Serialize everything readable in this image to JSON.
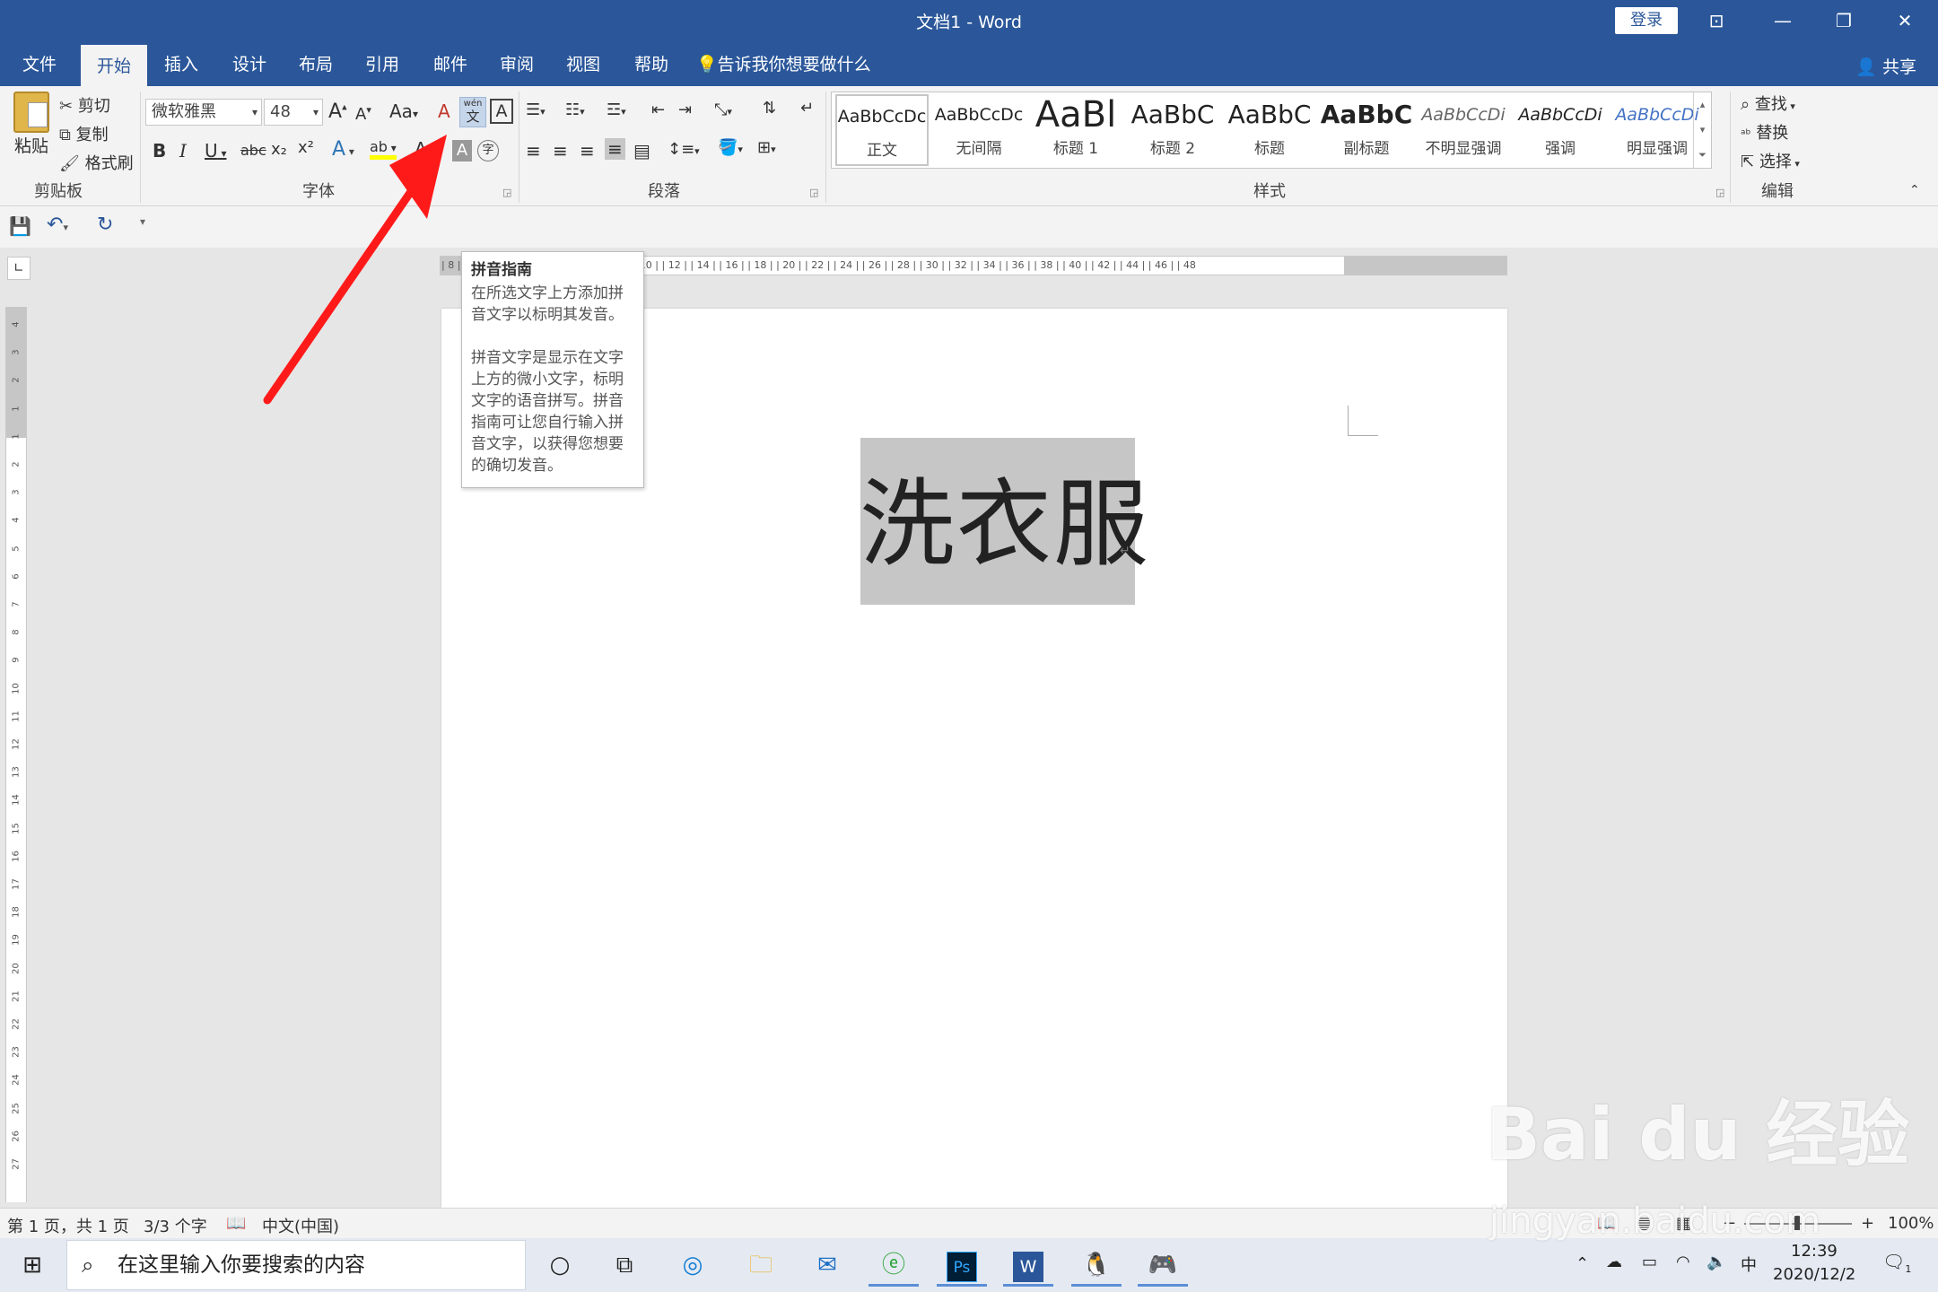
{
  "window": {
    "title": "文档1  -  Word",
    "login": "登录",
    "controls": {
      "ribbon_display": "⊡",
      "minimize": "—",
      "restore": "❐",
      "close": "✕"
    }
  },
  "tabs": {
    "file": "文件",
    "home": "开始",
    "insert": "插入",
    "design": "设计",
    "layout": "布局",
    "references": "引用",
    "mailings": "邮件",
    "review": "审阅",
    "view": "视图",
    "help": "帮助",
    "tell_me": "告诉我你想要做什么",
    "share": "共享"
  },
  "clipboard": {
    "paste": "粘贴",
    "cut": "剪切",
    "copy": "复制",
    "format_painter": "格式刷",
    "label": "剪贴板"
  },
  "font": {
    "name": "微软雅黑",
    "size": "48",
    "grow": "A",
    "shrink": "A",
    "change_case": "Aa",
    "clear": "A",
    "phonetic_top": "wén",
    "phonetic_bottom": "文",
    "border": "A",
    "bold": "B",
    "italic": "I",
    "underline": "U",
    "strike": "abc",
    "subscript": "x₂",
    "superscript": "x²",
    "effects": "A",
    "highlight": "ab",
    "color": "A",
    "shade": "A",
    "enclose": "字",
    "label": "字体"
  },
  "paragraph": {
    "label": "段落"
  },
  "styles": {
    "label": "样式",
    "items": [
      {
        "preview": "AaBbCcDc",
        "name": "正文"
      },
      {
        "preview": "AaBbCcDc",
        "name": "无间隔"
      },
      {
        "preview": "AaBl",
        "name": "标题 1"
      },
      {
        "preview": "AaBbC",
        "name": "标题 2"
      },
      {
        "preview": "AaBbC",
        "name": "标题"
      },
      {
        "preview": "AaBbC",
        "name": "副标题"
      },
      {
        "preview": "AaBbCcDi",
        "name": "不明显强调"
      },
      {
        "preview": "AaBbCcDi",
        "name": "强调"
      },
      {
        "preview": "AaBbCcDi",
        "name": "明显强调"
      }
    ]
  },
  "editing": {
    "find": "查找",
    "replace": "替换",
    "select": "选择",
    "label": "编辑"
  },
  "ruler": {
    "h_ticks": "| 8 |   | 6 |   | 4 |   | 2 |   |   |   | 2 |   | 4 |   | 6 |   | 8 |   | 10 |   | 12 |   | 14 |   | 16 |   | 18 |   | 20 |   | 22 |   | 24 |   | 26 |   | 28 |   | 30 |   | 32 |   | 34 |   | 36 |   | 38 |   | 40 |   | 42 |   | 44 |   | 46 |   | 48",
    "v_ticks": [
      "4",
      "3",
      "2",
      "1",
      "1",
      "2",
      "3",
      "4",
      "5",
      "6",
      "7",
      "8",
      "9",
      "10",
      "11",
      "12",
      "13",
      "14",
      "15",
      "16",
      "17",
      "18",
      "19",
      "20",
      "21",
      "22",
      "23",
      "24",
      "25",
      "26",
      "27"
    ]
  },
  "tooltip": {
    "title": "拼音指南",
    "p1": "在所选文字上方添加拼音文字以标明其发音。",
    "p2": "拼音文字是显示在文字上方的微小文字，标明文字的语音拼写。拼音指南可让您自行输入拼音文字，以获得您想要的确切发音。"
  },
  "document": {
    "text": "洗衣服",
    "para_mark": "↵"
  },
  "status": {
    "page": "第 1 页，共 1 页",
    "words": "3/3 个字",
    "language": "中文(中国)",
    "zoom_minus": "−",
    "zoom_plus": "+",
    "zoom": "100%"
  },
  "taskbar": {
    "search_placeholder": "在这里输入你要搜索的内容",
    "time": "12:39",
    "date": "2020/12/2",
    "ime": "中",
    "notifications": "1"
  },
  "watermark": {
    "brand": "Bai du 经验",
    "url": "jingyan.baidu.com"
  },
  "colors": {
    "accent": "#2b579a",
    "ribbon": "#f3f3f3",
    "arrow": "#ff1a1a",
    "selection": "#c6c6c6"
  }
}
